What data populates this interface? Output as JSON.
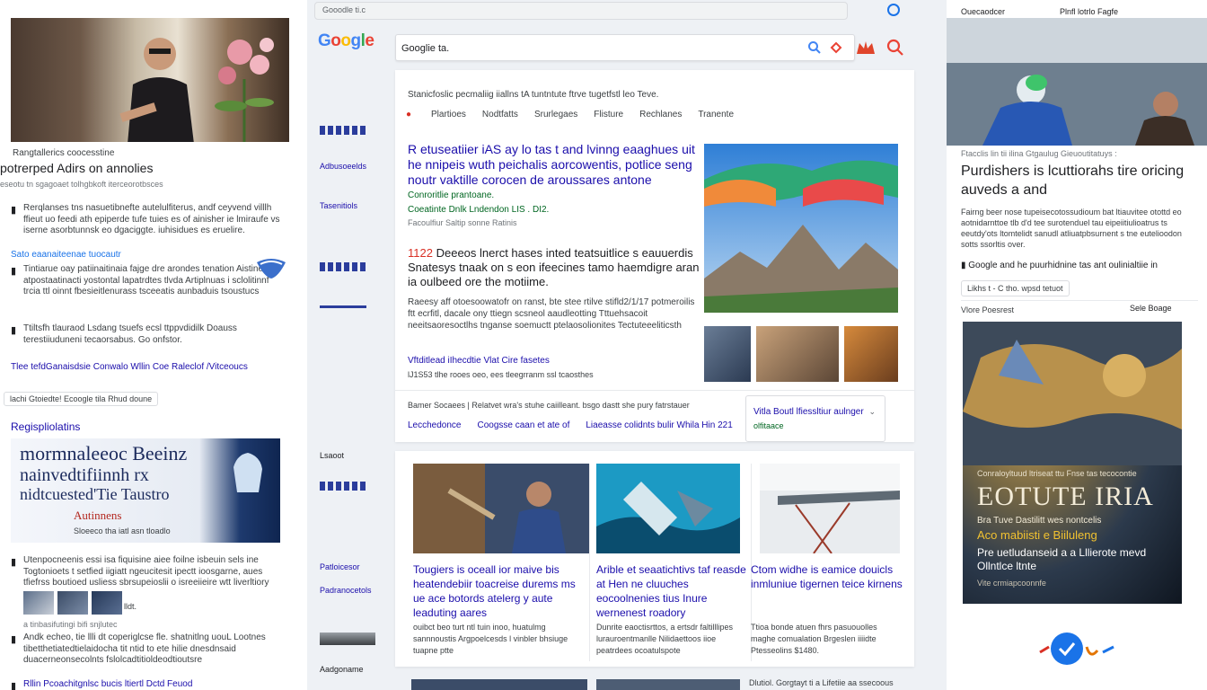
{
  "browser": {
    "url": "Gooodle ti.c",
    "search_query": "Googlie ta.",
    "logo": [
      "G",
      "o",
      "o",
      "g",
      "l",
      "e"
    ]
  },
  "left": {
    "hero_caption": "Rangtallerics coocesstine",
    "title": "potrerped Adirs on annolies",
    "subtitle": "eseotu tn sgagoaet tolhgbkoft iterceorotbsces",
    "block1": "Rerqlanses tns nasuetibnefte autelulfiterus, andf ceyvend villlh ffieut uo feedi ath epiperde tufe tuies es of ainisher ie lmiraufe vs iserne asorbtunnsk eo dgaciggte. iuhisidues es eruelire.",
    "link1": "Sato eaanaiteenae tuocautr",
    "block2": "Tintiarue oay patiinaitinaia fajge dre arondes tenation Aistine atpostaatinacti yostontal lapatrdtes tlvda Artiplnuas i sclolitinnf trcia ttl oinnt fbesieitlenurass tsceeatis aunbaduis tsoustucs",
    "block3": "Ttiltsfh tlauraod Lsdang tsuefs ecsl ttppvdidilk Doauss terestiiuduneni tecaorsabus. Go onfstor.",
    "link_row": "Tlee tefdGanaisdsie   Conwalo Wllin Coe Raleclof /Vitceoucs",
    "chip": "lachi Gtoiedte! Ecoogle tila Rhud doune",
    "section": "Regispliolatins",
    "banner": {
      "line1": "mormnaleeoc Beeinz",
      "line2": "nainvedtifiinnh rx",
      "line3": "nidtcuested'Tie Taustro",
      "line4": "Autinnens",
      "line5": "Sloeeco tha iatl asn tloadlo"
    },
    "block4": "Utenpocneenis essi isa fiquisine aiee foilne isbeuin sels ine Togtonioets t setfied iigiatt ngeucitesit ipectt ioosgarne, aues tfiefrss boutioed usliess sbrsupeioslii o isreeiieire wtt liverltiory",
    "thumb_caption": "lldt.",
    "small": "a tinbasifutingi bifi snjlutec",
    "block5": "Andk echeo, tie llli dt coperiglcse  fle. shatnitlng uouL Lootnes tibetthetiatedtielaidocha tit ntid to ete hilie dnesdnsaid duacerneonsecolnts fslolcadtitioldeodtioutsre",
    "block6": "Rllin  Pcoachitgnlsc bucis ltiertl Dctd Feuod"
  },
  "rail": {
    "item1": "Adbusoeelds",
    "item2": "Tasenitiols",
    "item3": "Lsaoot",
    "item4": "Patloicesor",
    "item5": "Padranocetols",
    "item6": "Aadgoname"
  },
  "results": {
    "header": "Stanicfoslic pecmaliig iiallns tA tuntntute ftrve tugetfstl leo Teve.",
    "tabs": [
      "Plartioes",
      "Nodtfatts",
      "Srurlegaes",
      "Flisture",
      "Rechlanes",
      "Tranente"
    ],
    "headline1": "R etuseatiier iAS ay lo tas t and lvinng eaaghues uit he nnipeis wuth peichalis aorcowentis, potlice seng noutr vaktille corocen de aroussares antone",
    "green1": "Conroritlie prantoane.",
    "green2": "Coeatinte Dnlk Lndendon LIS . DI2.",
    "meta1": "Facoulfiur Saltip sonne Ratinis",
    "headline2_red": "1122",
    "headline2": "Deeeos lnerct hases inted teatsuitlice s eauuerdis Snatesys tnaak on s eon ifeecines tamo haemdigre aran ia oulbeed ore the motiime.",
    "body": "Raeesy aff otoesoowatofr on ranst, bte stee rtilve stifld2/1/17 potmeroilis ftt ecrfitl, dacale ony ttiegn scsneol aaudleotting Tttuehsacoit neeitsaoresoctlhs tnganse soemuctt ptelaosolionites Tectuteeeliticsth",
    "link1": "Vftditlead iIhecdtie Vlat Cire fasetes",
    "link2": "lJ1S53 tlhe rooes oeo, ees tleegrranm ssl tcaosthes",
    "foot": "Bamer Socaees   |  Relatvet wra's stuhe caiilleant. bsgo dastt she pury fatrstauer",
    "foot_links": [
      "Lecchedonce",
      "Coogsse caan et ate of",
      "Liaeasse colidnts bulir Whila Hin 221"
    ],
    "box_title": "Vitla Boutl lfiessltiur aulnger",
    "box_sub": "olfitaace"
  },
  "news": [
    {
      "title": "Tougiers is oceall ior maive bis heatendebiir toacreise durems ms ue ace botords atelerg y aute leaduting aares",
      "meta": "ouibct beo turt ntl tuin inoo, huatulmg sannnoustis Argpoelcesds l vinbler bhsiuge tuapne ptte"
    },
    {
      "title": "Arible et seaatichtivs taf reasde at Hen ne cluuches eocoolnenies tius Inure wernenest roadory",
      "meta": "Dunrite eaoctisrttos, a ertsdr faltilllipes lurauroentmanlle Nilidaettoos iioe peatrdees ocoatulspote"
    },
    {
      "title": "Ctom widhe is eamice douicls inmluniue tigernen teice kirnens",
      "meta": "Ttioa bonde atuen fhrs pasuouolles maghe comualation Brgeslen iiiidte Ptesseolins $1480."
    }
  ],
  "bottom_strip": "Dlutiol. Gorgtayt ti a Lifetiie aa ssecoous",
  "right": {
    "top_left": "Ouecaodcer",
    "top_right": "Plnfl lotrlo Fagfe",
    "meta": "Ftacclis lin tii ilina Gtgaulug Gieuoutitatuys :",
    "title": "Purdishers is lcuttiorahs tire oricing auveds a and",
    "body": "Fairng beer nose tupeisecotossudioum bat ltiauvitee otottd eo aotnidarnttoe tlb d'd tee surotenduel tau eipeiitiulioatrus ts eeutdy'ots ltomtelidt sanudl atliuatpbsurnent s tne eutelioodon sotts ssorltis over.",
    "line": "Google and he puurhidnine tas ant oulinialtiie in",
    "chip": "Likhs t - C tho. wpsd tetuot",
    "from": "Vlore Poesrest",
    "badge": "Sele Boage",
    "poster": {
      "small": "Conraloyltuud ltriseat ttu Fnse tas tecocontie",
      "title": "EOTUTE IRIA",
      "sub": "Bra Tuve Dastilitt wes nontcelis",
      "yellow": "Aco mabiisti e Biiluleng",
      "desc": "Pre uetludanseid a a Lllierote mevd Ollntlce ltnte",
      "foot": "Vite crmiapcoonnfe"
    }
  },
  "colors": {
    "link": "#1a0dab",
    "green": "#006621",
    "accent_red": "#d93025",
    "google_blue": "#4285f4"
  }
}
